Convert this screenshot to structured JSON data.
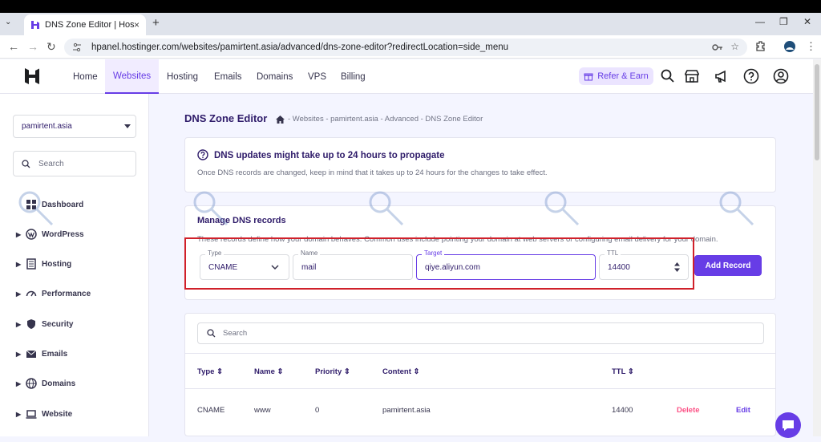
{
  "browser": {
    "tab_title": "DNS Zone Editor | Hostinger",
    "tab_close": "×",
    "new_tab": "+",
    "tab_menu": "⌄",
    "url": "hpanel.hostinger.com/websites/pamirtent.asia/advanced/dns-zone-editor?redirectLocation=side_menu",
    "win_min": "—",
    "win_max": "❐",
    "win_close": "✕",
    "back": "←",
    "forward": "→",
    "reload": "↻"
  },
  "header": {
    "menu": [
      "Home",
      "Websites",
      "Hosting",
      "Emails",
      "Domains",
      "VPS",
      "Billing"
    ],
    "active_index": 1,
    "refer_label": "Refer & Earn"
  },
  "sidebar": {
    "domain_select": "pamirtent.asia",
    "search_placeholder": "Search",
    "items": [
      "Dashboard",
      "WordPress",
      "Hosting",
      "Performance",
      "Security",
      "Emails",
      "Domains",
      "Website"
    ]
  },
  "page": {
    "title": "DNS Zone Editor",
    "breadcrumb": "- Websites - pamirtent.asia - Advanced - DNS Zone Editor"
  },
  "notice": {
    "title": "DNS updates might take up to 24 hours to propagate",
    "text": "Once DNS records are changed, keep in mind that it takes up to 24 hours for the changes to take effect."
  },
  "manage": {
    "title": "Manage DNS records",
    "description": "These records define how your domain behaves. Common uses include pointing your domain at web servers or configuring email delivery for your domain.",
    "type_label": "Type",
    "type_value": "CNAME",
    "name_label": "Name",
    "name_value": "mail",
    "target_label": "Target",
    "target_value": "qiye.aliyun.com",
    "ttl_label": "TTL",
    "ttl_value": "14400",
    "add_button": "Add Record"
  },
  "table": {
    "search_placeholder": "Search",
    "columns": [
      "Type",
      "Name",
      "Priority",
      "Content",
      "TTL"
    ],
    "rows": [
      {
        "type": "CNAME",
        "name": "www",
        "priority": "0",
        "content": "pamirtent.asia",
        "ttl": "14400",
        "delete": "Delete",
        "edit": "Edit"
      }
    ]
  },
  "colors": {
    "accent": "#673de6",
    "danger": "#fc5185",
    "highlight": "#d0202a"
  }
}
